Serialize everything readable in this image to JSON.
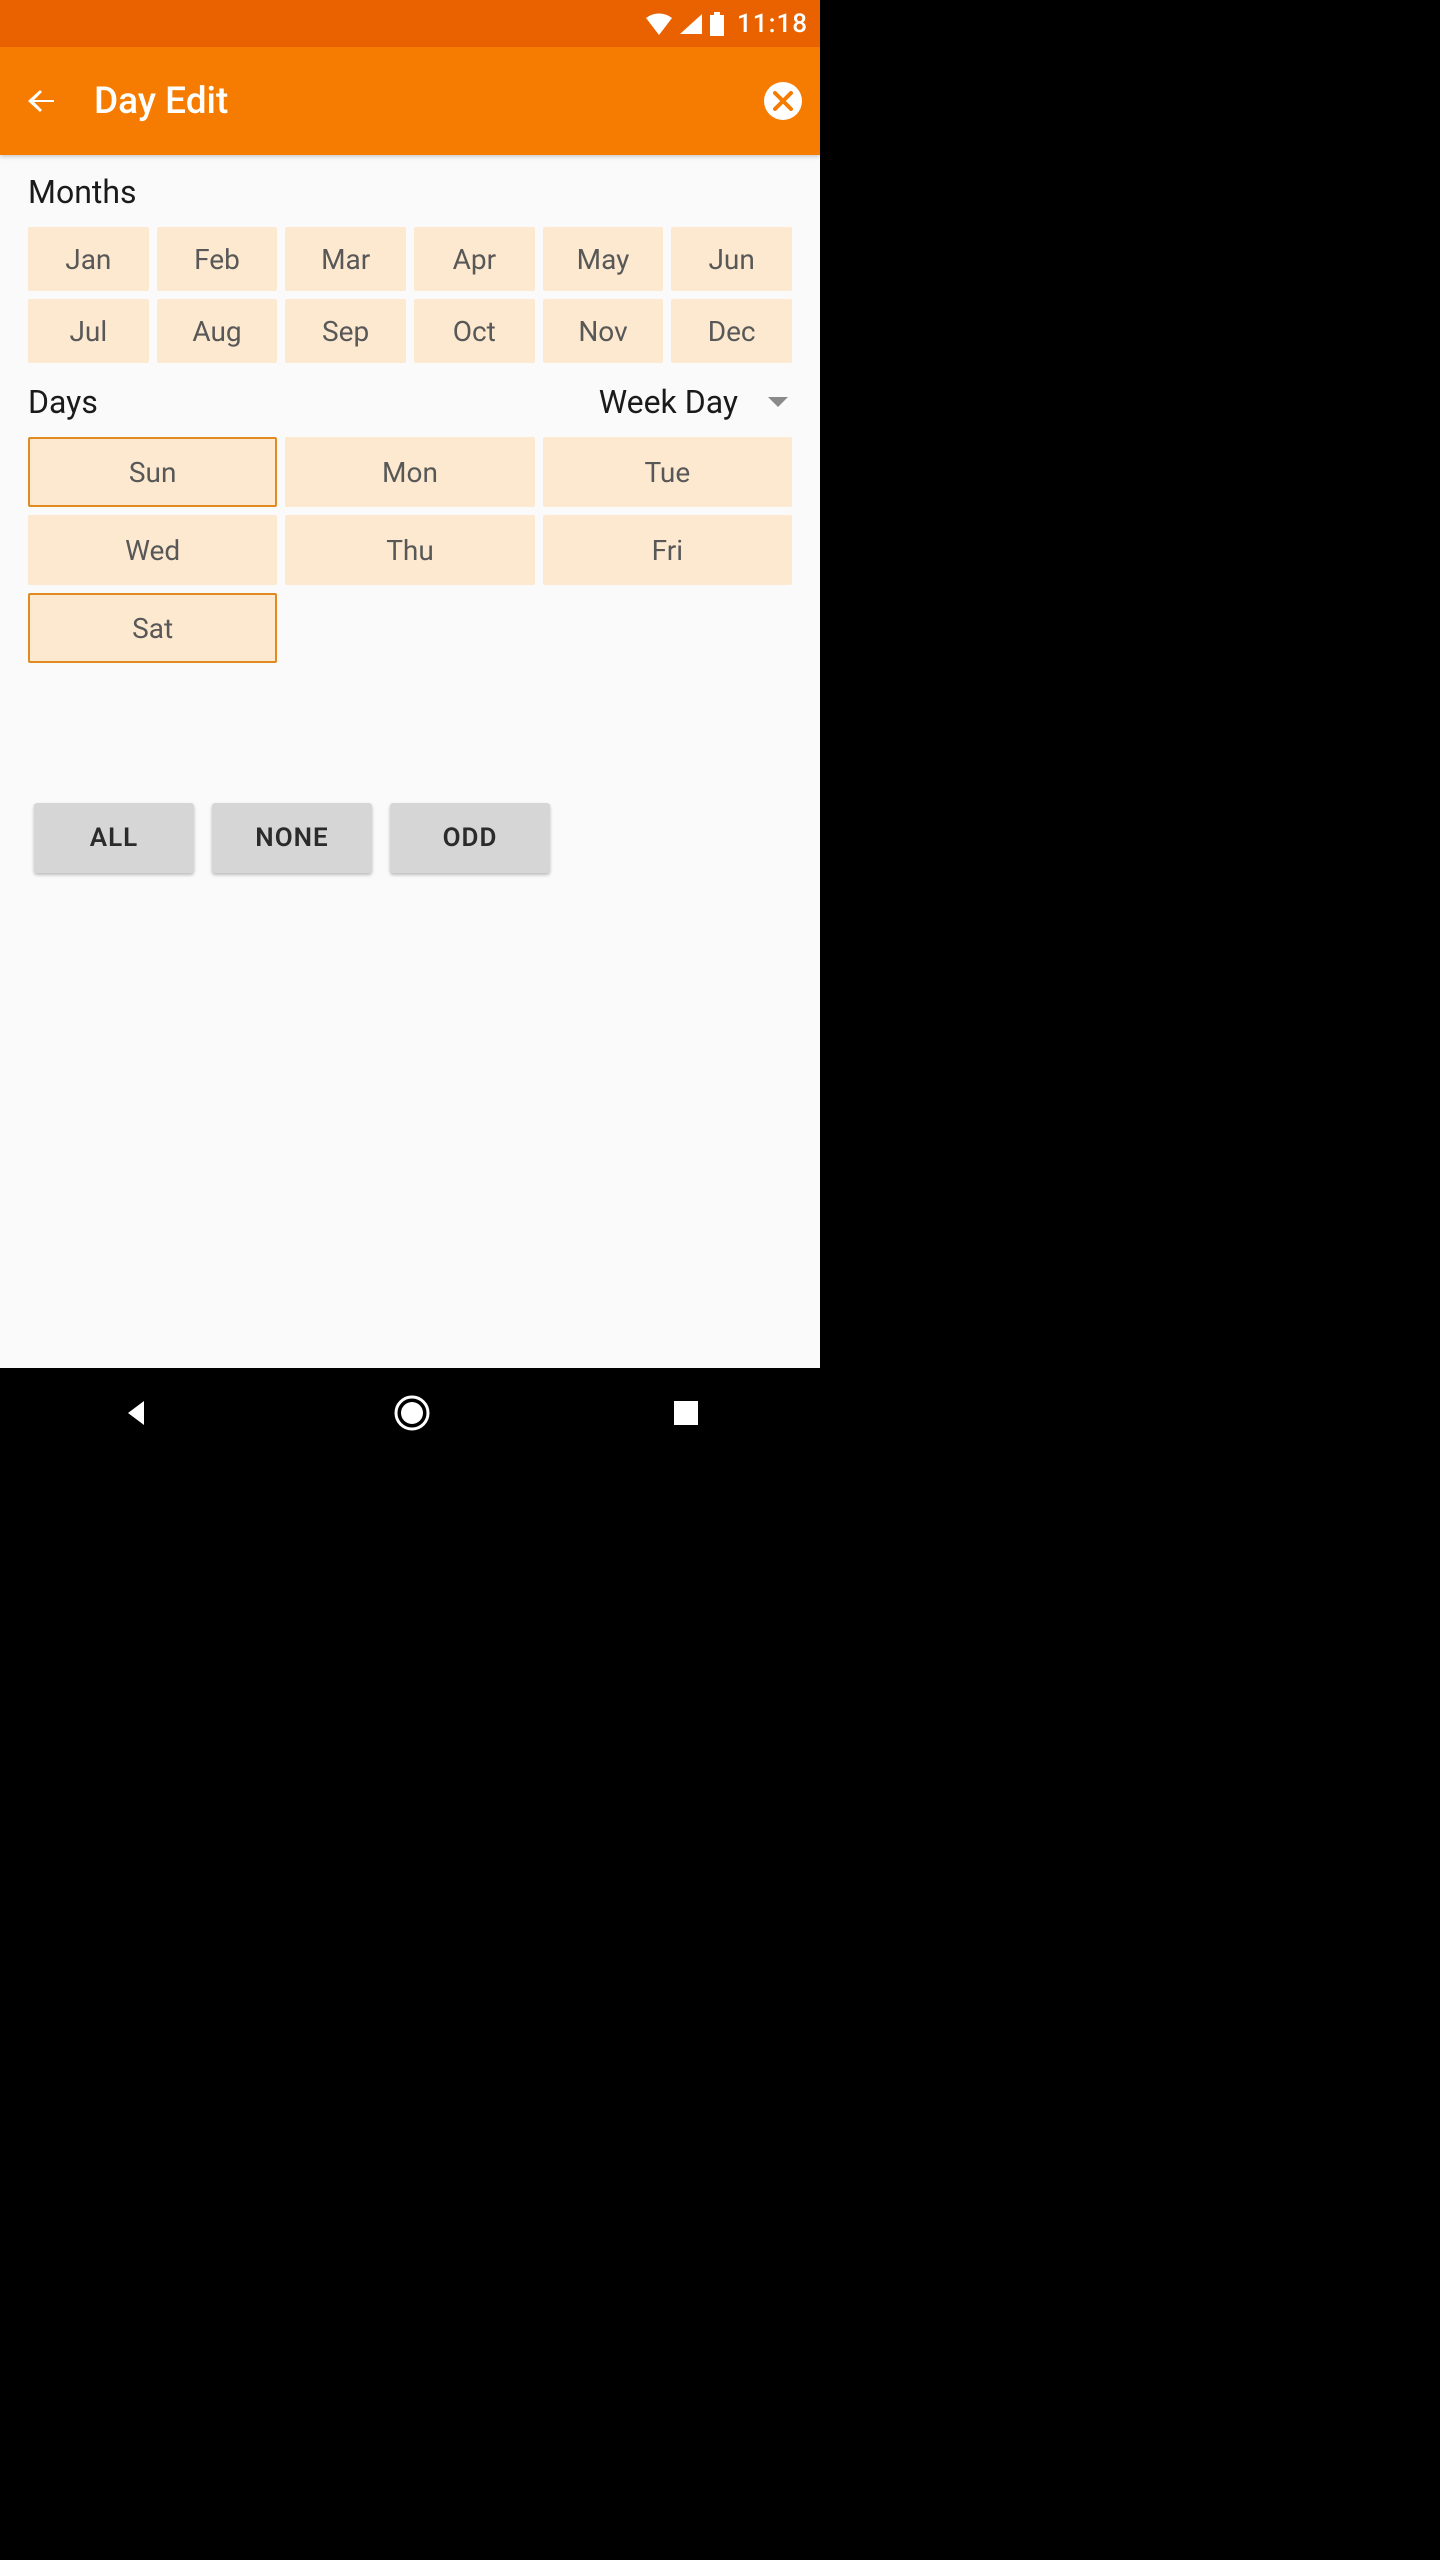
{
  "status": {
    "time": "11:18"
  },
  "appbar": {
    "title": "Day Edit"
  },
  "sections": {
    "months_label": "Months",
    "days_label": "Days"
  },
  "months": [
    "Jan",
    "Feb",
    "Mar",
    "Apr",
    "May",
    "Jun",
    "Jul",
    "Aug",
    "Sep",
    "Oct",
    "Nov",
    "Dec"
  ],
  "days": [
    {
      "label": "Sun",
      "selected": true
    },
    {
      "label": "Mon",
      "selected": false
    },
    {
      "label": "Tue",
      "selected": false
    },
    {
      "label": "Wed",
      "selected": false
    },
    {
      "label": "Thu",
      "selected": false
    },
    {
      "label": "Fri",
      "selected": false
    },
    {
      "label": "Sat",
      "selected": true
    }
  ],
  "days_mode": {
    "selected": "Week Day"
  },
  "actions": {
    "all": "ALL",
    "none": "NONE",
    "odd": "ODD"
  }
}
